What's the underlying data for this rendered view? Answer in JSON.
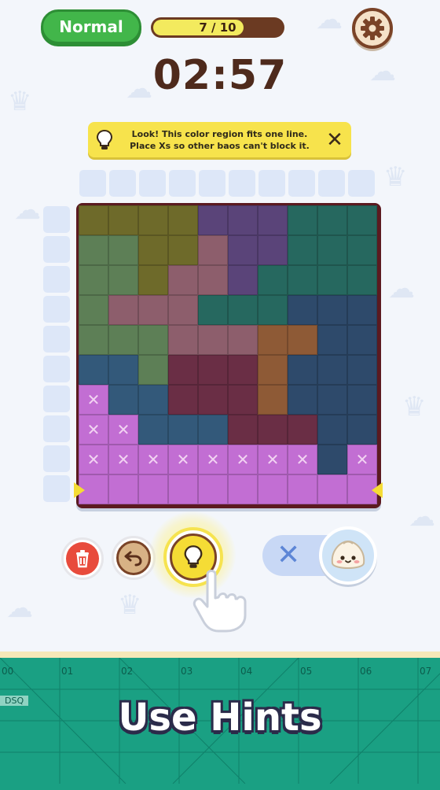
{
  "header": {
    "difficulty_label": "Normal",
    "progress_text": "7 / 10",
    "progress_fraction": 0.7,
    "settings_icon": "gear-icon"
  },
  "timer": "02:57",
  "hint_banner": {
    "line1": "Look! This color region fits one line.",
    "line2": "Place Xs so other baos can't block it.",
    "icon": "lightbulb-icon",
    "close_glyph": "✕"
  },
  "board": {
    "size": 10,
    "colors": {
      "O": "#6e6a2a",
      "G": "#5d7f56",
      "P": "#5a4479",
      "T": "#26685f",
      "R": "#8d5e6c",
      "M": "#6a2e45",
      "B": "#33597a",
      "N": "#2e4a6b",
      "K": "#8e5a36",
      "L": "#c26ed3"
    },
    "rows": [
      "OOOOPPPTTT",
      "GGOORPPTTT",
      "GGORRPTTTT",
      "GRRRTTTNNN",
      "GGGRRRKKNN",
      "BBGMMMKNNN",
      "LBBMMMKNNN",
      "LLBBBMMMNN",
      "LLLLLLLLNL",
      "LLLLLLLLLL"
    ],
    "x_marks": [
      [
        6,
        0
      ],
      [
        7,
        0
      ],
      [
        7,
        1
      ],
      [
        8,
        0
      ],
      [
        8,
        1
      ],
      [
        8,
        2
      ],
      [
        8,
        3
      ],
      [
        8,
        4
      ],
      [
        8,
        5
      ],
      [
        8,
        6
      ],
      [
        8,
        7
      ],
      [
        8,
        9
      ]
    ],
    "x_glyph": "✕"
  },
  "controls": {
    "delete_icon": "trash-icon",
    "undo_icon": "undo-icon",
    "hint_icon": "lightbulb-icon",
    "mark_mode_glyph": "✕",
    "bao_icon": "bao-face-icon"
  },
  "footer": {
    "ruler_numbers": [
      "00",
      "01",
      "02",
      "03",
      "04",
      "05",
      "06",
      "07"
    ],
    "mat_label": "DSQ",
    "headline": "Use Hints"
  }
}
